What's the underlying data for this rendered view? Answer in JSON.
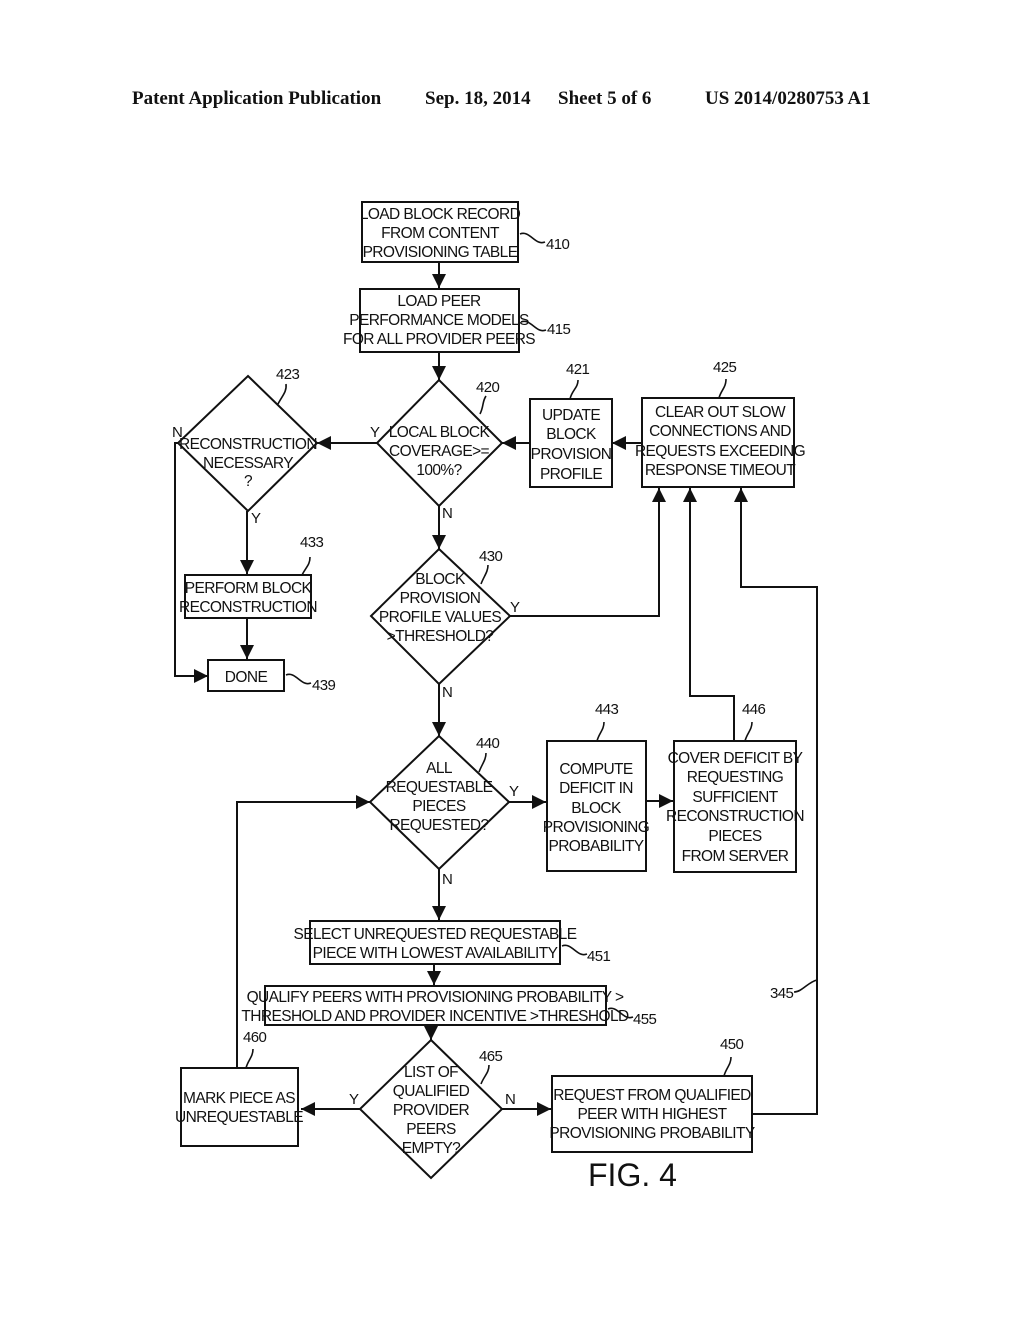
{
  "header": {
    "publication": "Patent Application Publication",
    "date": "Sep. 18, 2014",
    "sheet": "Sheet 5 of 6",
    "number": "US 2014/0280753 A1"
  },
  "figure_label": "FIG. 4",
  "nodes": {
    "n410": {
      "ref": "410",
      "lines": [
        "LOAD BLOCK RECORD",
        "FROM CONTENT",
        "PROVISIONING TABLE"
      ]
    },
    "n415": {
      "ref": "415",
      "lines": [
        "LOAD PEER",
        "PERFORMANCE MODELS",
        "FOR ALL PROVIDER PEERS"
      ]
    },
    "n420": {
      "ref": "420",
      "lines": [
        "LOCAL BLOCK",
        "COVERAGE>=",
        "100%?"
      ]
    },
    "n421": {
      "ref": "421",
      "lines": [
        "UPDATE",
        "BLOCK",
        "PROVISION",
        "PROFILE"
      ]
    },
    "n423": {
      "ref": "423",
      "lines": [
        "RECONSTRUCTION",
        "NECESSARY",
        "?"
      ]
    },
    "n425": {
      "ref": "425",
      "lines": [
        "CLEAR OUT SLOW",
        "CONNECTIONS AND",
        "REQUESTS EXCEEDING",
        "RESPONSE TIMEOUT"
      ]
    },
    "n430": {
      "ref": "430",
      "lines": [
        "BLOCK",
        "PROVISION",
        "PROFILE VALUES",
        ">THRESHOLD?"
      ]
    },
    "n433": {
      "ref": "433",
      "lines": [
        "PERFORM BLOCK",
        "RECONSTRUCTION"
      ]
    },
    "n439": {
      "ref": "439",
      "lines": [
        "DONE"
      ]
    },
    "n440": {
      "ref": "440",
      "lines": [
        "ALL",
        "REQUESTABLE",
        "PIECES",
        "REQUESTED?"
      ]
    },
    "n443": {
      "ref": "443",
      "lines": [
        "COMPUTE",
        "DEFICIT IN",
        "BLOCK",
        "PROVISIONING",
        "PROBABILITY"
      ]
    },
    "n446": {
      "ref": "446",
      "lines": [
        "COVER DEFICIT BY",
        "REQUESTING",
        "SUFFICIENT",
        "RECONSTRUCTION",
        "PIECES",
        "FROM SERVER"
      ]
    },
    "n451": {
      "ref": "451",
      "lines": [
        "SELECT UNREQUESTED REQUESTABLE",
        "PIECE WITH LOWEST AVAILABILITY"
      ]
    },
    "n455": {
      "ref": "455",
      "lines": [
        "QUALIFY PEERS WITH PROVISIONING PROBABILITY >",
        "THRESHOLD AND PROVIDER INCENTIVE >THRESHOLD"
      ]
    },
    "n460": {
      "ref": "460",
      "lines": [
        "MARK PIECE AS",
        "UNREQUESTABLE"
      ]
    },
    "n465": {
      "ref": "465",
      "lines": [
        "LIST OF",
        "QUALIFIED",
        "PROVIDER",
        "PEERS",
        "EMPTY?"
      ]
    },
    "n450": {
      "ref": "450",
      "lines": [
        "REQUEST FROM QUALIFIED",
        "PEER WITH HIGHEST",
        "PROVISIONING PROBABILITY"
      ]
    }
  },
  "connector_ref": "345",
  "branch_labels": {
    "yes": "Y",
    "no": "N"
  }
}
